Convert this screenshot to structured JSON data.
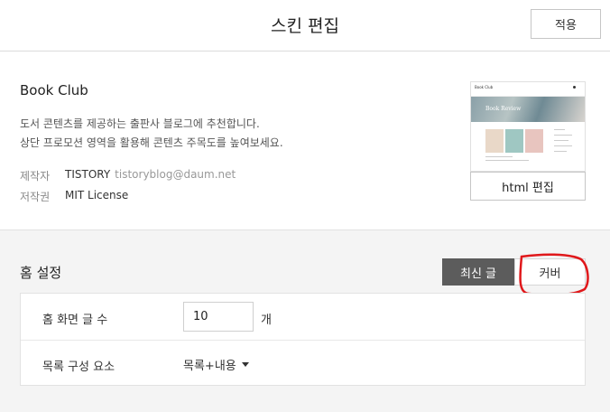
{
  "header": {
    "title": "스킨 편집",
    "apply_label": "적용"
  },
  "skin": {
    "name": "Book Club",
    "description_line1": "도서 콘텐츠를 제공하는 출판사 블로그에 추천합니다.",
    "description_line2": "상단 프로모션 영역을 활용해 콘텐츠 주목도를 높여보세요.",
    "maker_label": "제작자",
    "maker_name": "TISTORY",
    "maker_email": "tistoryblog@daum.net",
    "license_label": "저작권",
    "license_value": "MIT License",
    "html_edit_label": "html 편집",
    "thumbnail": {
      "site_title": "Book Club",
      "hero_title": "Book Review"
    }
  },
  "home_settings": {
    "title": "홈 설정",
    "tabs": [
      {
        "label": "최신 글",
        "active": true
      },
      {
        "label": "커버",
        "active": false
      }
    ],
    "rows": [
      {
        "label": "홈 화면 글 수",
        "value": "10",
        "unit": "개"
      },
      {
        "label": "목록 구성 요소",
        "value": "목록+내용"
      }
    ]
  },
  "colors": {
    "active_tab": "#5c5c5c",
    "annotation": "#e0181b"
  },
  "icons": [
    "dropdown-caret-icon"
  ]
}
